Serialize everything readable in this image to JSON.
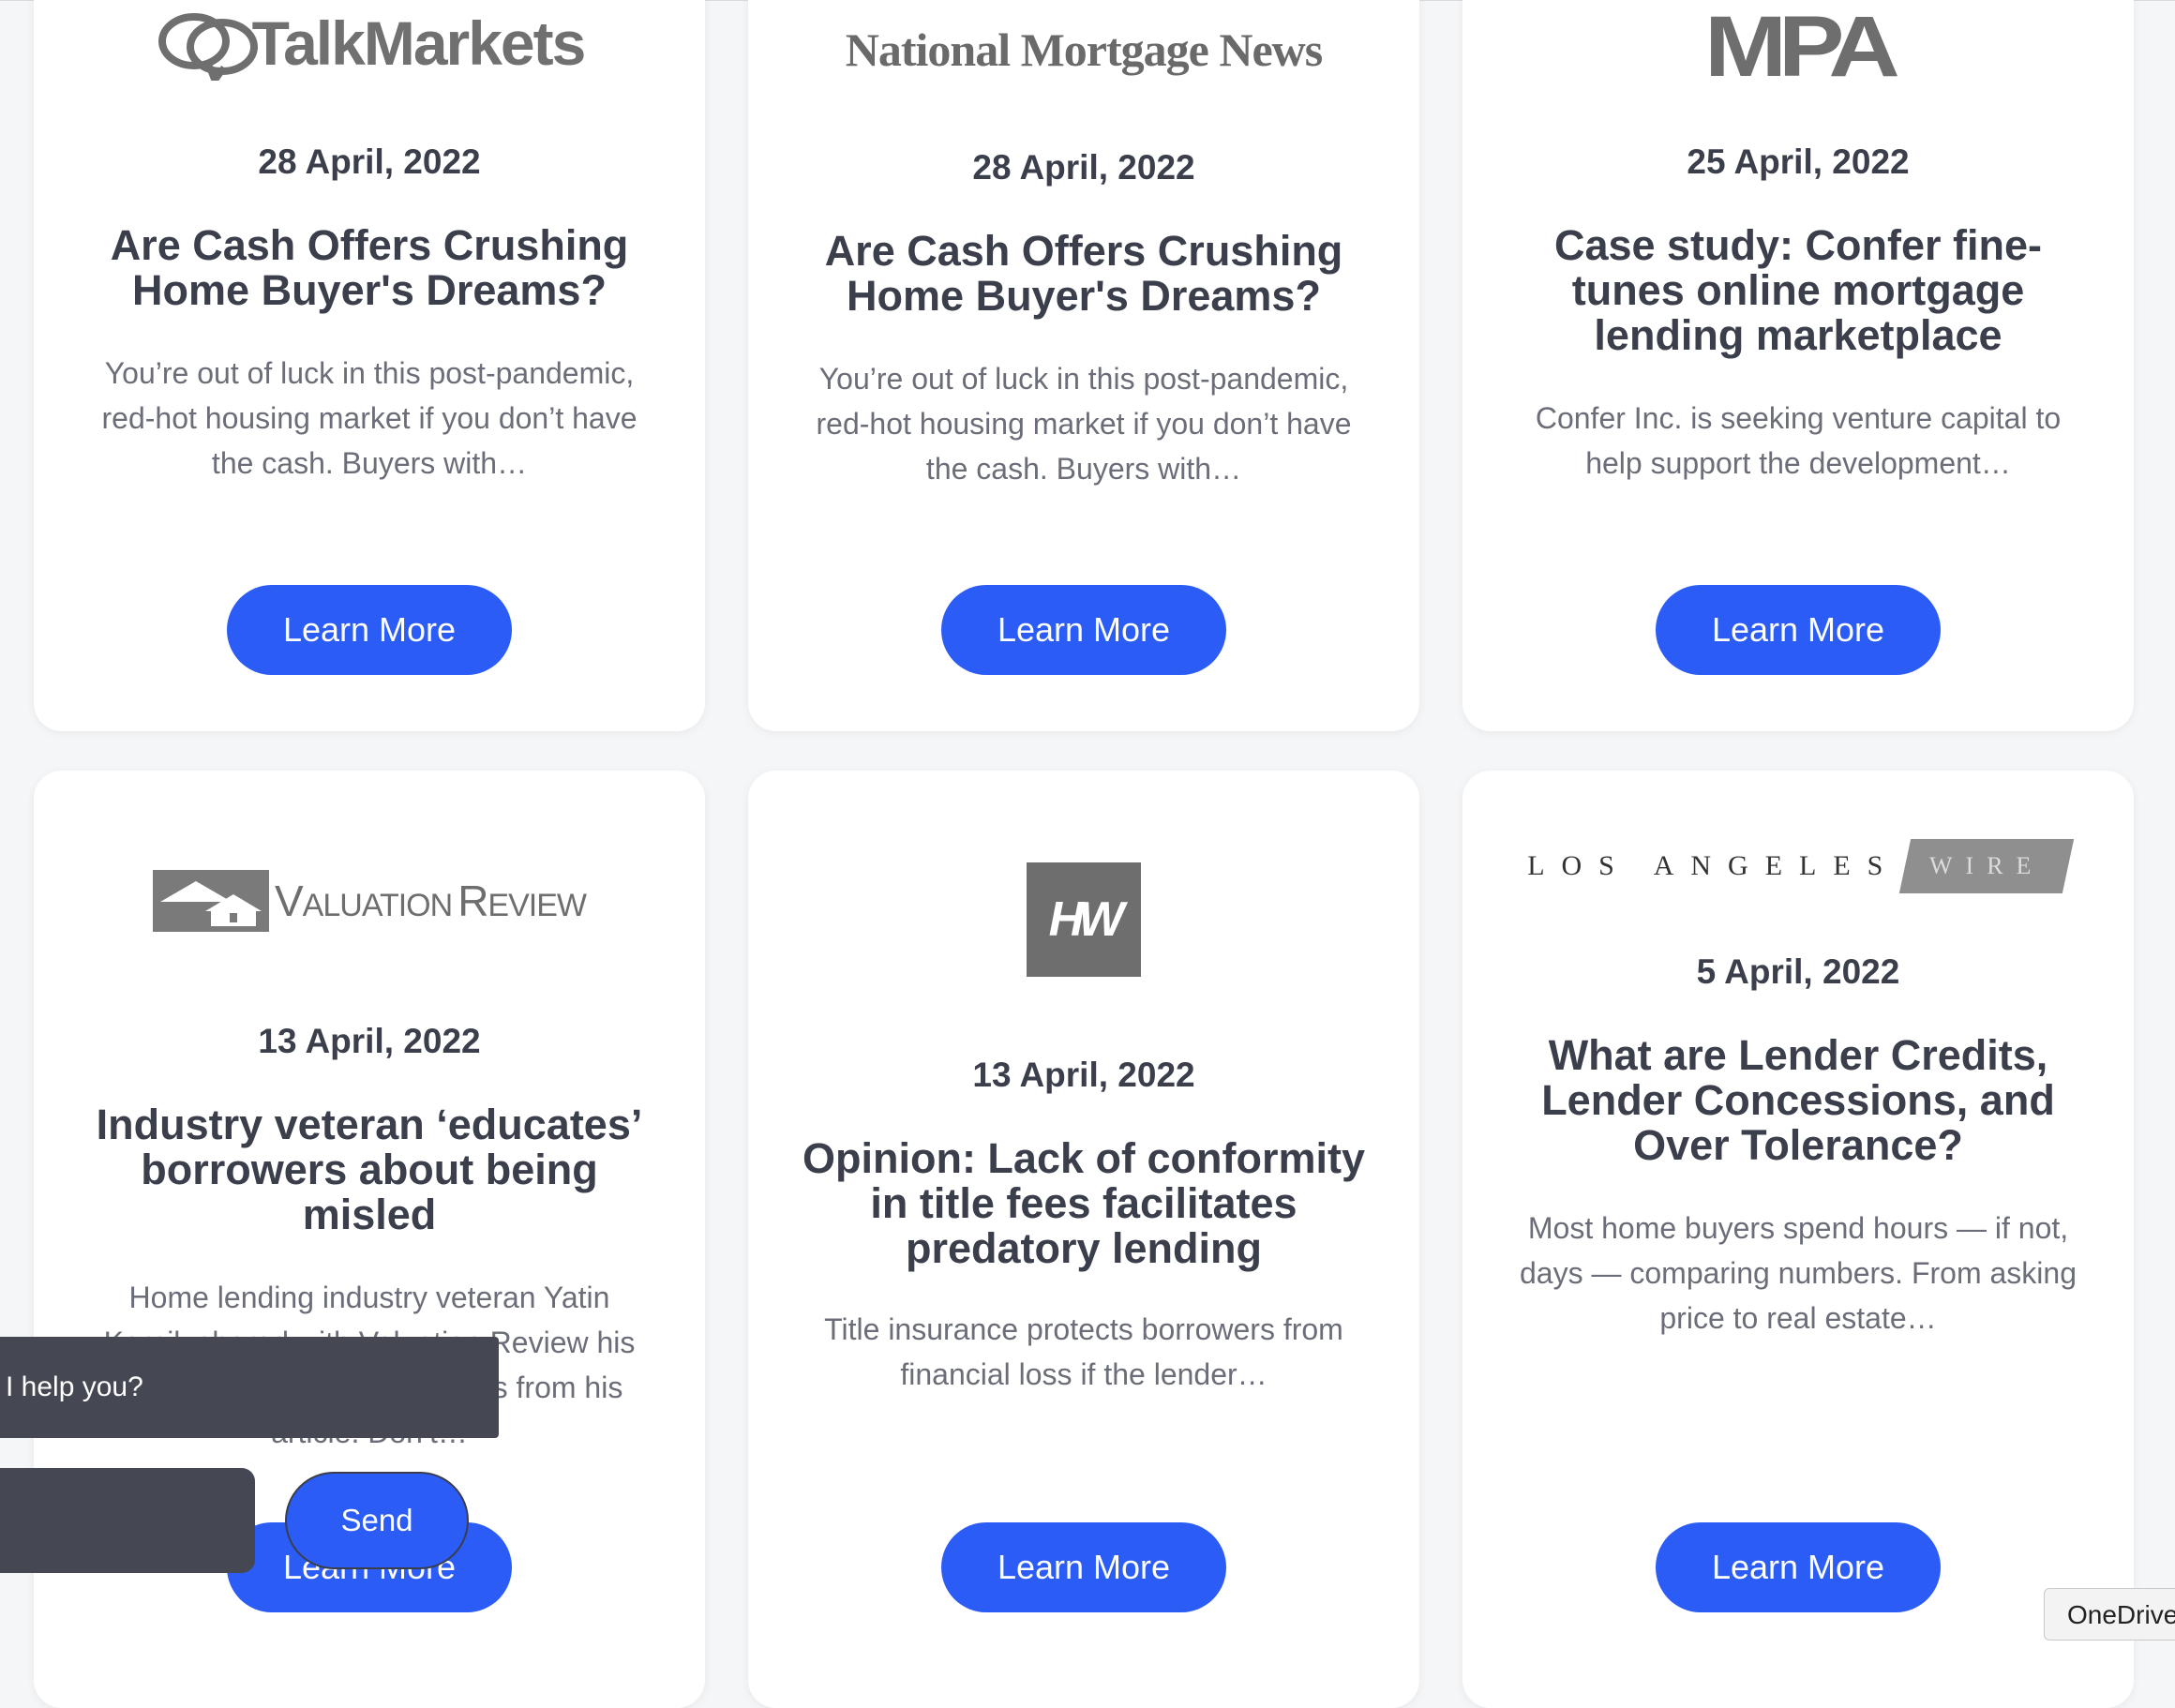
{
  "cards": [
    {
      "publisher": "TalkMarkets",
      "date": "28 April, 2022",
      "title": "Are Cash Offers Crushing Home Buyer's Dreams?",
      "excerpt": "You’re out of luck in this post-pandemic, red-hot housing market if you don’t have the cash. Buyers with…",
      "button": "Learn More"
    },
    {
      "publisher": "National Mortgage News",
      "date": "28 April, 2022",
      "title": "Are Cash Offers Crushing Home Buyer's Dreams?",
      "excerpt": "You’re out of luck in this post-pandemic, red-hot housing market if you don’t have the cash. Buyers with…",
      "button": "Learn More"
    },
    {
      "publisher": "MPA",
      "date": "25 April, 2022",
      "title": "Case study: Confer fine-tunes online mortgage lending marketplace",
      "excerpt": "Confer Inc. is seeking venture capital to help support the development…",
      "button": "Learn More"
    },
    {
      "publisher": "Valuation Review",
      "publisher_v": "V",
      "publisher_aluation": "ALUATION",
      "publisher_r": "R",
      "publisher_eview": "EVIEW",
      "date": "13 April, 2022",
      "title": "Industry veteran ‘educates’ borrowers about being misled",
      "excerpt": "Home lending industry veteran Yatin Karnik shared with Valuation Review his mission to educate borrowers from his article. Don’t…",
      "button": "Learn More"
    },
    {
      "publisher": "HW",
      "date": "13 April, 2022",
      "title": "Opinion: Lack of conformity in title fees facilitates predatory lending",
      "excerpt": "Title insurance protects borrowers from financial loss if the lender…",
      "button": "Learn More"
    },
    {
      "publisher_main": "LOS ANGELES",
      "publisher_tag": "WIRE",
      "date": "5 April, 2022",
      "title": "What are Lender Credits, Lender Concessions, and Over Tolerance?",
      "excerpt": "Most home buyers spend hours — if not, days — comparing numbers. From asking price to real estate…",
      "button": "Learn More"
    }
  ],
  "chat": {
    "message": "I help you?",
    "send": "Send"
  },
  "onedrive": "OneDrive",
  "colors": {
    "accent": "#2b5cf6",
    "card": "#ffffff",
    "text": "#3b3f4c",
    "chat": "#454753"
  }
}
